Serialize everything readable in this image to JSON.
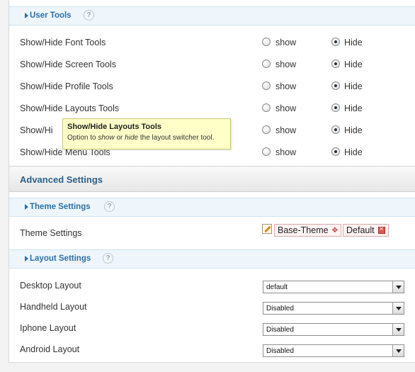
{
  "user_tools": {
    "title": "User Tools",
    "help": "?",
    "rows": [
      {
        "label": "Show/Hide Font Tools",
        "show_label": "show",
        "hide_label": "Hide",
        "selected": "Hide"
      },
      {
        "label": "Show/Hide Screen Tools",
        "show_label": "show",
        "hide_label": "Hide",
        "selected": "Hide"
      },
      {
        "label": "Show/Hide Profile Tools",
        "show_label": "show",
        "hide_label": "Hide",
        "selected": "Hide"
      },
      {
        "label": "Show/Hide Layouts Tools",
        "show_label": "show",
        "hide_label": "Hide",
        "selected": "Hide"
      },
      {
        "label": "Show/Hi",
        "show_label": "show",
        "hide_label": "Hide",
        "selected": "Hide"
      },
      {
        "label": "Show/Hide Menu Tools",
        "show_label": "show",
        "hide_label": "Hide",
        "selected": "Hide"
      }
    ],
    "tooltip": {
      "title": "Show/Hide Layouts Tools",
      "text_before": "Option to ",
      "em1": "show",
      "text_mid": " or ",
      "em2": "hide",
      "text_after": " the layout switcher tool."
    }
  },
  "advanced": {
    "title": "Advanced Settings"
  },
  "theme_settings": {
    "title": "Theme Settings",
    "help": "?",
    "label": "Theme Settings",
    "theme_tag": "Base-Theme",
    "default_tag": "Default"
  },
  "layout_settings": {
    "title": "Layout Settings",
    "help": "?",
    "rows": [
      {
        "label": "Desktop Layout",
        "value": "default"
      },
      {
        "label": "Handheld Layout",
        "value": "Disabled"
      },
      {
        "label": "Iphone Layout",
        "value": "Disabled"
      },
      {
        "label": "Android Layout",
        "value": "Disabled"
      }
    ]
  },
  "colors": {
    "accent": "#2b6fa8",
    "tooltip_bg": "#ffffc8"
  }
}
